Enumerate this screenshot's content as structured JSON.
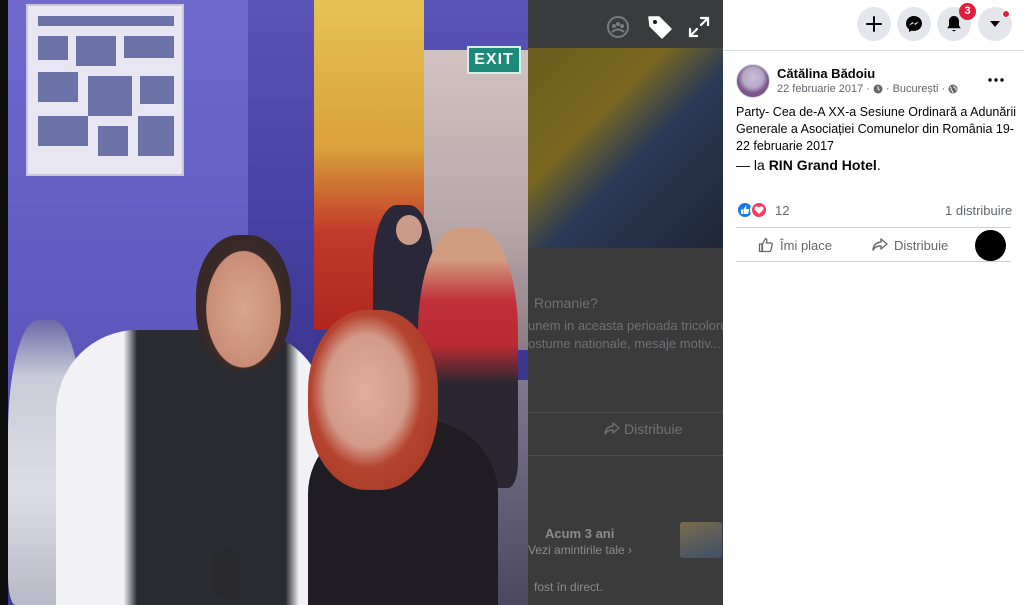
{
  "viewer": {
    "icons": {
      "profile": "profile-circle-icon",
      "tag": "tag-icon",
      "fullscreen": "expand-icon"
    },
    "photo": {
      "exit_sign": "EXIT"
    },
    "background_feed": {
      "question": "Romanie?",
      "line1": "unem in aceasta perioada tricoloru",
      "line2": "ostume nationale, mesaje motiv... V",
      "share_label": "Distribuie",
      "memory_time": "Acum 3 ani",
      "memory_link": "Vezi amintirile tale",
      "live_text": "fost în direct."
    }
  },
  "topbar": {
    "create_icon": "plus-icon",
    "messenger_icon": "messenger-icon",
    "notifications_icon": "bell-icon",
    "notifications_count": "3",
    "account_icon": "caret-down-icon"
  },
  "post": {
    "author": "Cătălina Bădoiu",
    "date": "22 februarie 2017",
    "location": "București",
    "text": "Party- Cea de-A XX-a Sesiune Ordinară a Adunării Generale a Asociației Comunelor din România 19-22 februarie 2017",
    "checkin_prefix": "— la",
    "checkin_place": "RIN Grand Hotel",
    "checkin_suffix": ".",
    "reaction_count": "12",
    "share_count": "1 distribuire",
    "like_label": "Îmi place",
    "share_label": "Distribuie"
  },
  "colors": {
    "accent": "#1877f2",
    "love": "#f33e58",
    "badge": "#e41e3f",
    "muted_text": "#65676b"
  }
}
